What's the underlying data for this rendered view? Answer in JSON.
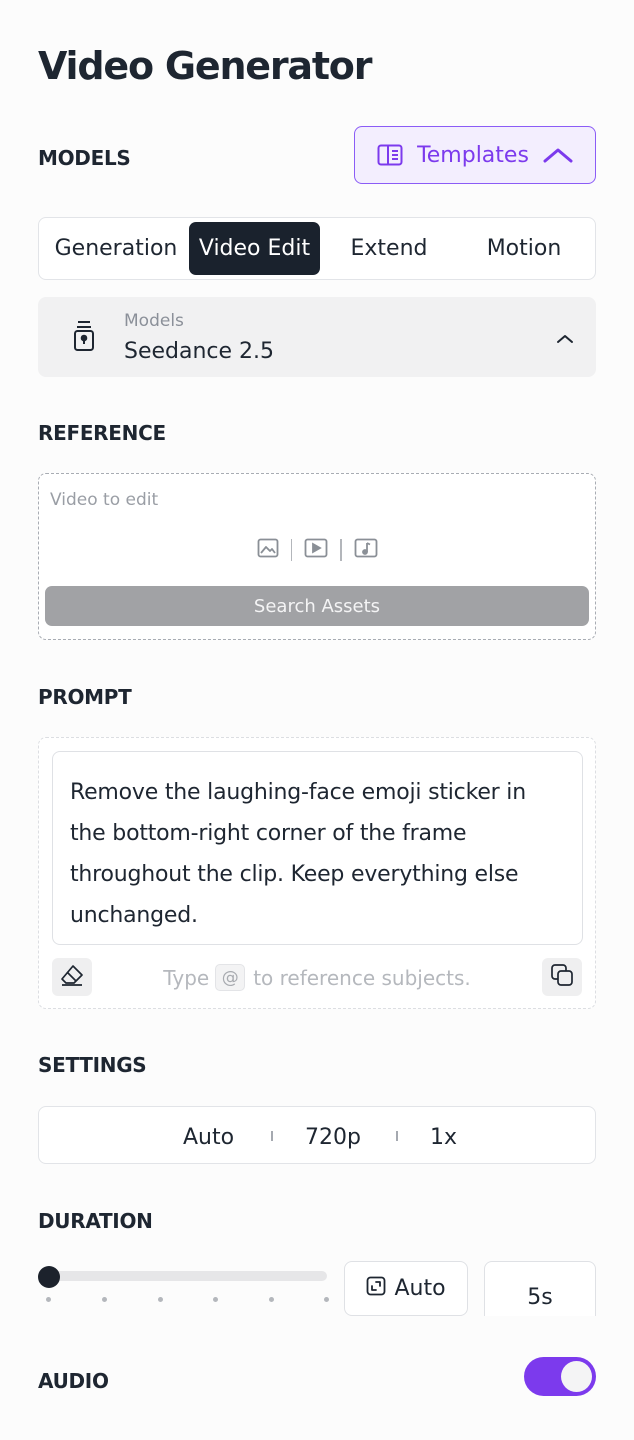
{
  "page": {
    "title": "Video Generator"
  },
  "models_section": {
    "label": "MODELS",
    "templates_button": {
      "label": "Templates",
      "icon": "book-open-icon",
      "chevron": "chevron-up-icon"
    }
  },
  "tabs": [
    {
      "label": "Generation",
      "active": false
    },
    {
      "label": "Video Edit",
      "active": true
    },
    {
      "label": "Extend",
      "active": false
    },
    {
      "label": "Motion",
      "active": false
    }
  ],
  "model_select": {
    "caption": "Models",
    "value": "Seedance 2.5",
    "icon": "model-icon",
    "chevron": "chevron-up-icon"
  },
  "reference": {
    "label": "REFERENCE",
    "caption": "Video to edit",
    "icons": [
      "image-icon",
      "video-icon",
      "music-icon"
    ],
    "search_button": "Search Assets"
  },
  "prompt": {
    "label": "PROMPT",
    "text": "Remove the laughing-face emoji sticker in the bottom-right corner of the frame throughout the clip. Keep everything else unchanged.",
    "hint_before": "Type",
    "hint_chip": "@",
    "hint_after": "to reference subjects."
  },
  "settings": {
    "label": "SETTINGS",
    "aspect": "Auto",
    "resolution": "720p",
    "count": "1x"
  },
  "duration": {
    "label": "DURATION",
    "slider_fraction": 0,
    "auto_button": "Auto",
    "value": "5s"
  },
  "audio": {
    "label": "AUDIO",
    "enabled": true
  },
  "colors": {
    "accent": "#7c3aed",
    "dark": "#1a222d"
  }
}
